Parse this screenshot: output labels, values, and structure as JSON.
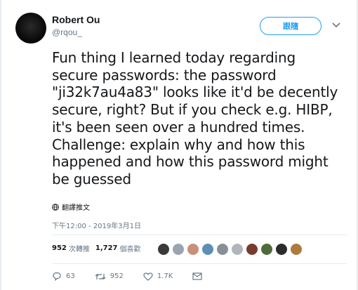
{
  "author": {
    "name": "Robert Ou",
    "handle": "@rqou_"
  },
  "follow_button": {
    "label": "跟隨"
  },
  "tweet": {
    "lines": [
      "Fun thing I learned today regarding",
      "secure passwords: the password",
      "\"ji32k7au4a83\" looks like it'd be decently",
      "secure, right? But if you check e.g. HIBP,",
      "it's been seen over a hundred times.",
      "Challenge: explain why and how this",
      "happened and how this password might",
      "be guessed"
    ]
  },
  "translate": {
    "label": "翻譯推文",
    "icon": "globe-icon"
  },
  "timestamp": "下午12:00 - 2019年3月1日",
  "stats": {
    "retweets": "952",
    "retweets_label": "次轉推",
    "likes": "1,727",
    "likes_label": "個喜歡"
  },
  "likers": [
    {
      "color": "#3a3a3a"
    },
    {
      "color": "#9aa5b1"
    },
    {
      "color": "#c98f7a"
    },
    {
      "color": "#5b8fb9"
    },
    {
      "color": "#8a8f96"
    },
    {
      "color": "#b0b6bc"
    },
    {
      "color": "#7a3b2e"
    },
    {
      "color": "#4f6b3a"
    },
    {
      "color": "#2c2c2c"
    },
    {
      "color": "#b07a3c"
    }
  ],
  "actions": {
    "reply_count": "63",
    "retweet_count": "952",
    "like_count": "1.7K"
  },
  "colors": {
    "accent": "#1da1f2",
    "muted": "#657786",
    "text": "#14171a"
  }
}
